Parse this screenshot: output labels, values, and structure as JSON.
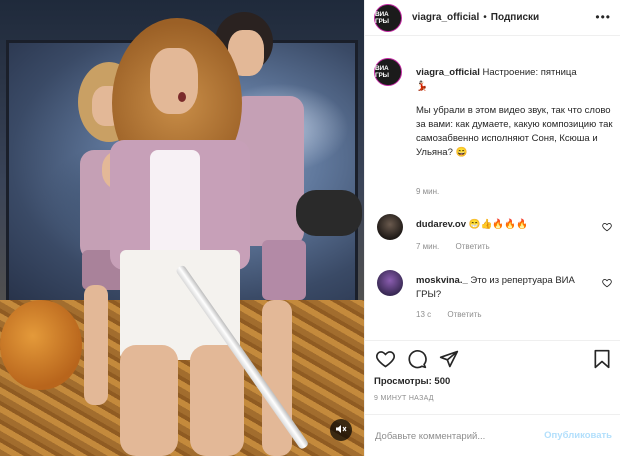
{
  "post": {
    "username": "viagra_official",
    "follow_label": "Подписки",
    "separator": "•",
    "avatar_text": "ВИА ГРЫ"
  },
  "caption": {
    "username": "viagra_official",
    "title": "Настроение: пятница",
    "emoji": "💃🏻",
    "body": "Мы убрали в этом видео звук, так что слово за вами: как думаете, какую композицию так самозабвенно исполняют Соня, Ксюша и Ульяна? 😄",
    "time": "9 мин."
  },
  "comments": [
    {
      "username": "dudarev.ov",
      "text": "😁👍🔥🔥🔥",
      "time": "7 мин.",
      "reply_label": "Ответить"
    },
    {
      "username": "moskvina._",
      "text": "Это из репертуара ВИА ГРЫ?",
      "time": "13 с",
      "reply_label": "Ответить"
    }
  ],
  "stats": {
    "views": "Просмотры: 500",
    "ago": "9 МИНУТ НАЗАД"
  },
  "composer": {
    "placeholder": "Добавьте комментарий...",
    "publish_label": "Опубликовать"
  },
  "colors": {
    "publish_disabled": "#b2dffc",
    "meta_gray": "#8e8e8e",
    "text": "#262626"
  }
}
